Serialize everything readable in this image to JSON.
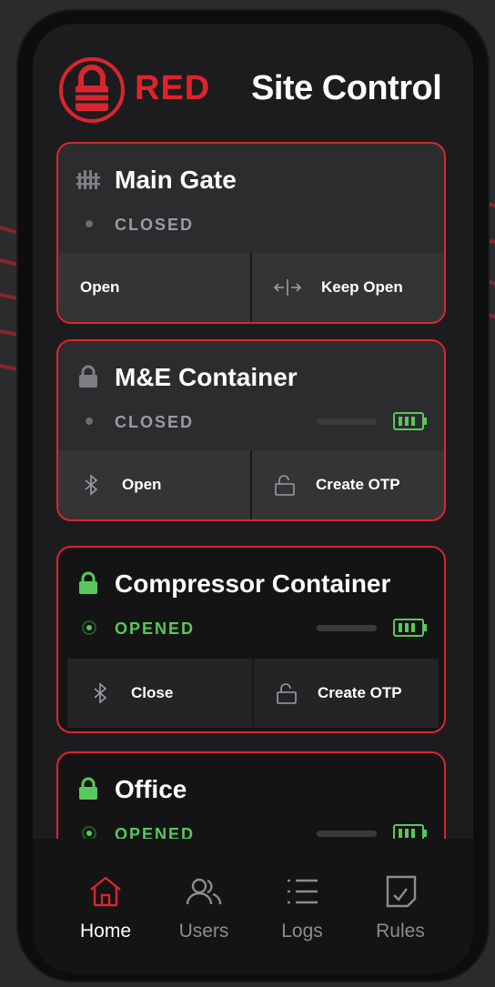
{
  "header": {
    "brand": "RED",
    "title": "Site Control",
    "accent_color": "#e0232b"
  },
  "doors": [
    {
      "name": "Main Gate",
      "icon": "gate-icon",
      "status": "CLOSED",
      "actions": [
        {
          "label": "Open",
          "icon": ""
        },
        {
          "label": "Keep Open",
          "icon": "keep-open-icon"
        }
      ]
    },
    {
      "name": "M&E Container",
      "icon": "lock-closed-icon",
      "status": "CLOSED",
      "battery": "full",
      "actions": [
        {
          "label": "Open",
          "icon": "bluetooth-icon"
        },
        {
          "label": "Create OTP",
          "icon": "unlock-icon"
        }
      ]
    },
    {
      "name": "Compressor Container",
      "icon": "lock-open-icon",
      "status": "OPENED",
      "battery": "full",
      "actions": [
        {
          "label": "Close",
          "icon": "bluetooth-icon"
        },
        {
          "label": "Create OTP",
          "icon": "unlock-icon"
        }
      ]
    },
    {
      "name": "Office",
      "icon": "lock-open-icon",
      "status": "OPENED",
      "battery": "full"
    }
  ],
  "nav": [
    {
      "label": "Home",
      "icon": "home-icon",
      "active": true
    },
    {
      "label": "Users",
      "icon": "users-icon",
      "active": false
    },
    {
      "label": "Logs",
      "icon": "list-icon",
      "active": false
    },
    {
      "label": "Rules",
      "icon": "rules-icon",
      "active": false
    }
  ],
  "colors": {
    "border_red": "#d9262e",
    "status_green": "#59c85c",
    "status_gray": "#9b9ba0"
  }
}
